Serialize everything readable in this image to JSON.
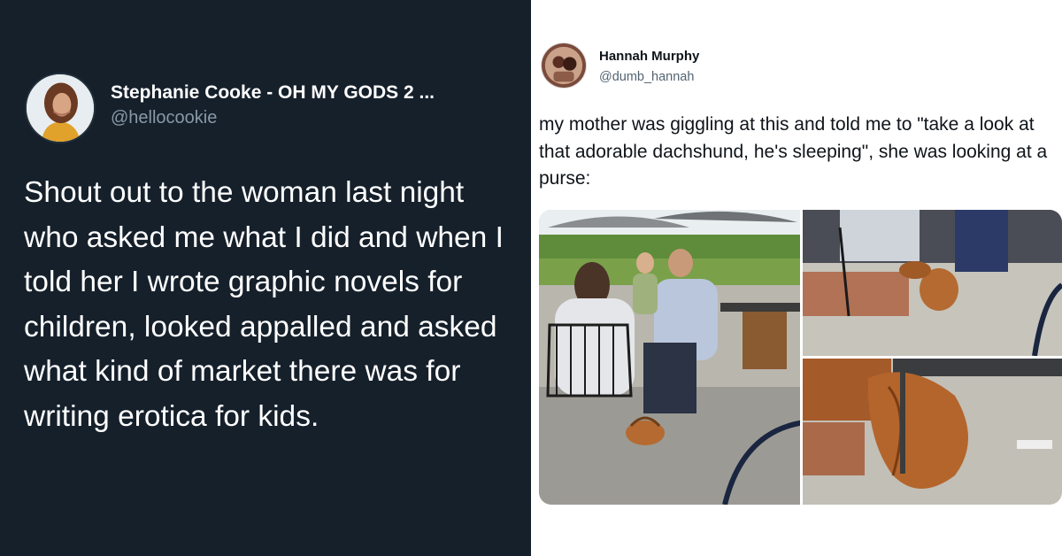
{
  "left_tweet": {
    "display_name": "Stephanie Cooke - OH MY GODS 2 ...",
    "handle": "@hellocookie",
    "text": "Shout out to the woman last night who asked me what I did and when I told her I wrote graphic novels for children, looked appalled and asked what kind of market there was for writing erotica for kids.",
    "avatar_icon": "profile-photo-woman",
    "background_color": "#15202b",
    "text_color": "#ffffff",
    "secondary_text_color": "#8899a6"
  },
  "right_tweet": {
    "display_name": "Hannah Murphy",
    "handle": "@dumb_hannah",
    "text": "my mother was giggling at this and told me to \"take a look at that adorable dachshund, he's sleeping\", she was looking at a purse:",
    "avatar_icon": "profile-photo",
    "media": {
      "layout": "three-photo-grid",
      "photos": [
        "patio-scene-photo",
        "purse-closeup-photo-1",
        "purse-closeup-photo-2"
      ]
    },
    "background_color": "#ffffff",
    "text_color": "#0f1419",
    "secondary_text_color": "#536471"
  }
}
